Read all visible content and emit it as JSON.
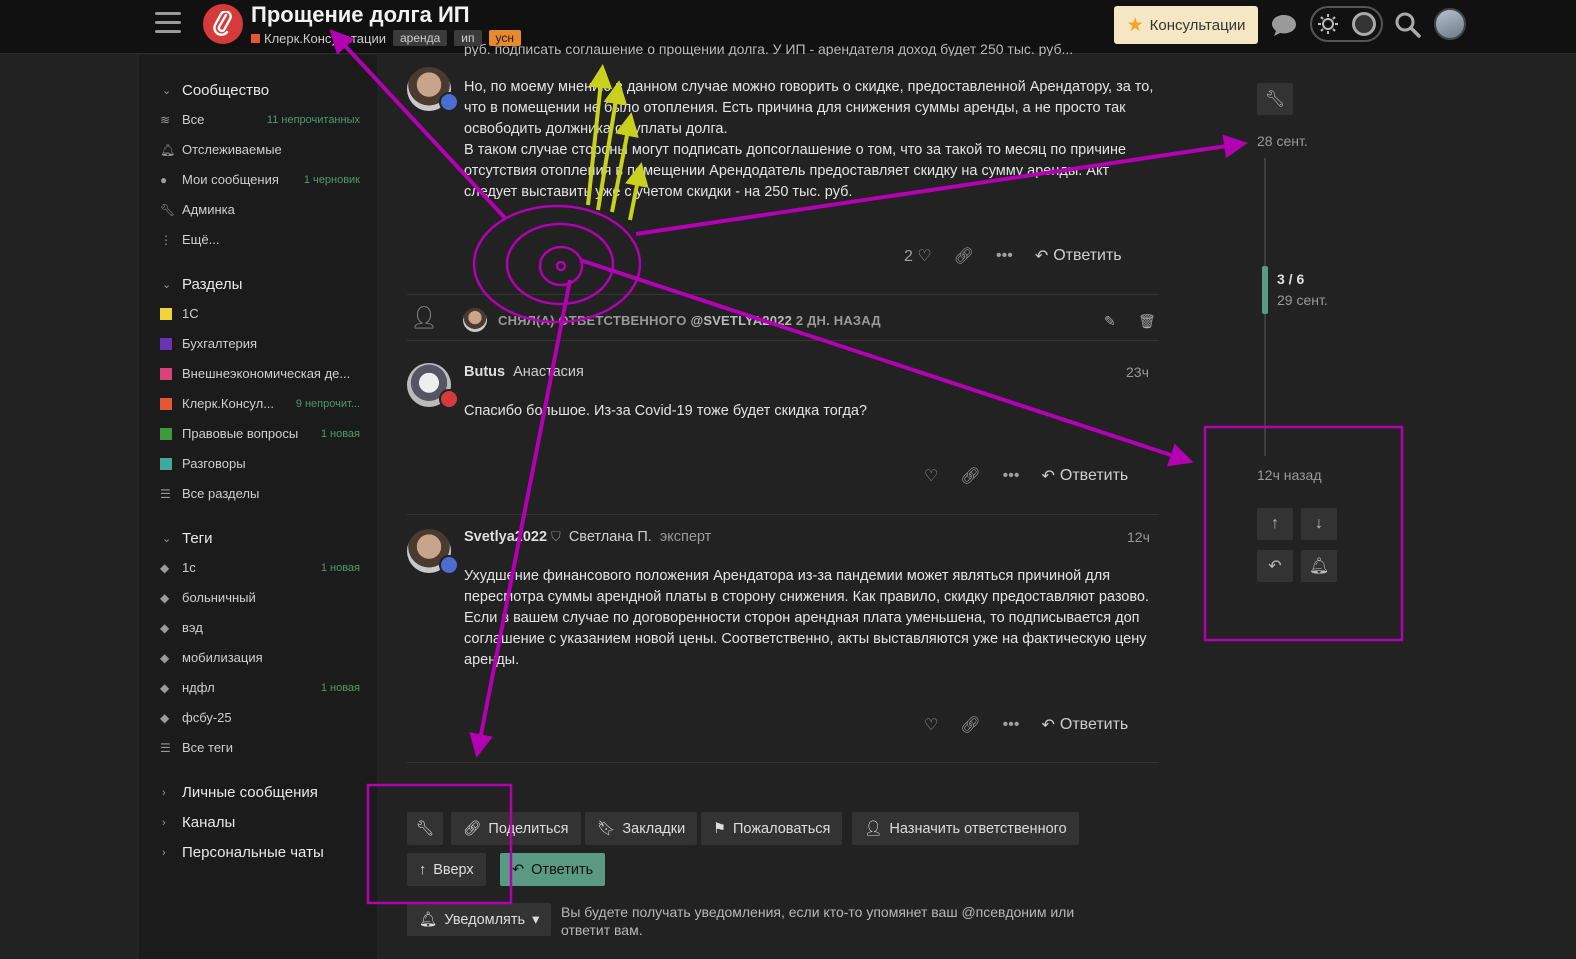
{
  "header": {
    "title": "Прощение долга ИП",
    "category": "Клерк.Консультации",
    "tags": [
      "аренда",
      "ип",
      "усн"
    ],
    "consult_button": "Консультации",
    "colors": {
      "accent": "#5b9a82",
      "logo": "#d63b3b",
      "annotation": "#b200b2",
      "arrow_yellow": "#c8d21e"
    }
  },
  "sidebar": {
    "community": {
      "label": "Сообщество",
      "items": [
        {
          "label": "Все",
          "badge": "11 непрочитанных"
        },
        {
          "label": "Отслеживаемые",
          "badge": ""
        },
        {
          "label": "Мои сообщения",
          "badge": "1 черновик"
        },
        {
          "label": "Админка",
          "badge": ""
        },
        {
          "label": "Ещё...",
          "badge": ""
        }
      ]
    },
    "sections": {
      "label": "Разделы",
      "items": [
        {
          "label": "1С",
          "badge": "",
          "color": "#f1d33b"
        },
        {
          "label": "Бухгалтерия",
          "badge": "",
          "color": "#6b32b3"
        },
        {
          "label": "Внешнеэкономическая де...",
          "badge": "",
          "color": "#d8437a"
        },
        {
          "label": "Клерк.Консул...",
          "badge": "9 непрочит...",
          "color": "#e45735"
        },
        {
          "label": "Правовые вопросы",
          "badge": "1 новая",
          "color": "#3f9a3b"
        },
        {
          "label": "Разговоры",
          "badge": "",
          "color": "#3fa9a0"
        },
        {
          "label": "Все разделы",
          "badge": ""
        }
      ]
    },
    "tags": {
      "label": "Теги",
      "items": [
        {
          "label": "1с",
          "badge": "1 новая"
        },
        {
          "label": "больничный",
          "badge": ""
        },
        {
          "label": "вэд",
          "badge": ""
        },
        {
          "label": "мобилизация",
          "badge": ""
        },
        {
          "label": "ндфл",
          "badge": "1 новая"
        },
        {
          "label": "фсбу-25",
          "badge": ""
        },
        {
          "label": "Все теги",
          "badge": ""
        }
      ]
    },
    "extra": [
      "Личные сообщения",
      "Каналы",
      "Персональные чаты"
    ]
  },
  "posts": {
    "top_cut": "руб. подписать соглашение о прощении долга. У ИП - арендателя доход будет 250 тыс. руб...",
    "post1": {
      "text": "Но, по моему мнению в данном случае можно говорить о скидке, предоставленной Арендатору, за то, что в помещении не было отопления. Есть причина для снижения суммы аренды, а не просто так освободить должника от уплаты долга.\nВ таком случае стороны могут подписать допсоглашение о том, что за такой то месяц по причине отсутствия отопления в помещении Арендодатель предоставляет скидку на сумму аренды. Акт следует выставить уже с учетом скидки - на 250 тыс. руб.",
      "likes": "2",
      "reply": "Ответить"
    },
    "small_action": {
      "text": "СНЯЛ(А) ОТВЕТСТВЕННОГО",
      "user": "@SVETLYA2022",
      "when": "2 ДН. НАЗАД"
    },
    "post2": {
      "username": "Butus",
      "realname": "Анастасия",
      "date": "23ч",
      "text": "Спасибо большое. Из-за Covid-19 тоже будет скидка тогда?",
      "reply": "Ответить"
    },
    "post3": {
      "username": "Svetlya2022",
      "realname": "Светлана П.",
      "title": "эксперт",
      "date": "12ч",
      "text": "Ухудшение финансового положения Арендатора из-за пандемии может являться причиной для пересмотра суммы арендной платы в сторону снижения. Как правило, скидку предоставляют разово. Если в вашем случае по договоренности сторон арендная плата уменьшена, то подписывается доп соглашение с указанием новой цены. Соответственно, акты выставляются уже на фактическую цену аренды.",
      "reply": "Ответить"
    }
  },
  "footer": {
    "share": "Поделиться",
    "bookmark": "Закладки",
    "flag": "Пожаловаться",
    "assign": "Назначить ответственного",
    "top": "Вверх",
    "reply": "Ответить",
    "notify": "Уведомлять",
    "notify_text": "Вы будете получать уведомления, если кто-то упомянет ваш @псевдоним или ответит вам."
  },
  "timeline": {
    "start_date": "28 сент.",
    "position": "3 / 6",
    "position_date": "29 сент.",
    "end": "12ч назад"
  }
}
